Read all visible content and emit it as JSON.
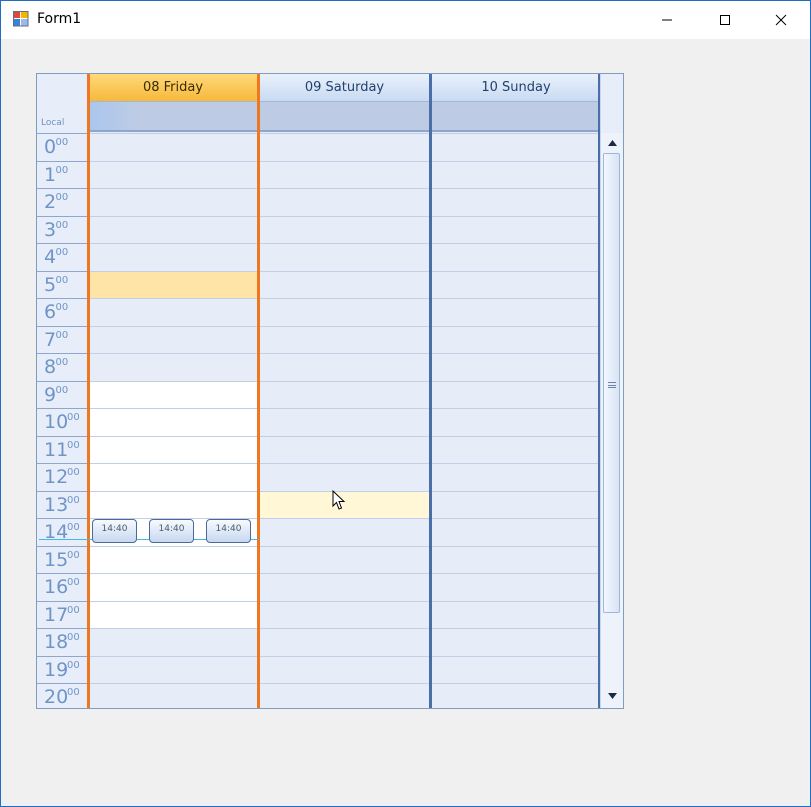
{
  "window": {
    "title": "Form1",
    "buttons": {
      "minimize": "minimize-icon",
      "maximize": "maximize-icon",
      "close": "close-icon"
    }
  },
  "scheduler": {
    "time_zone_label": "Local",
    "days": [
      {
        "label": "08 Friday",
        "today": true
      },
      {
        "label": "09 Saturday",
        "today": false
      },
      {
        "label": "10 Sunday",
        "today": false
      }
    ],
    "hours": [
      {
        "h": "0",
        "m": "00"
      },
      {
        "h": "1",
        "m": "00"
      },
      {
        "h": "2",
        "m": "00"
      },
      {
        "h": "3",
        "m": "00"
      },
      {
        "h": "4",
        "m": "00"
      },
      {
        "h": "5",
        "m": "00"
      },
      {
        "h": "6",
        "m": "00"
      },
      {
        "h": "7",
        "m": "00"
      },
      {
        "h": "8",
        "m": "00"
      },
      {
        "h": "9",
        "m": "00"
      },
      {
        "h": "10",
        "m": "00"
      },
      {
        "h": "11",
        "m": "00"
      },
      {
        "h": "12",
        "m": "00"
      },
      {
        "h": "13",
        "m": "00"
      },
      {
        "h": "14",
        "m": "00"
      },
      {
        "h": "15",
        "m": "00"
      },
      {
        "h": "16",
        "m": "00"
      },
      {
        "h": "17",
        "m": "00"
      },
      {
        "h": "18",
        "m": "00"
      },
      {
        "h": "19",
        "m": "00"
      },
      {
        "h": "20",
        "m": "00"
      }
    ],
    "appointments": [
      {
        "label": "14:40"
      },
      {
        "label": "14:40"
      },
      {
        "label": "14:40"
      }
    ],
    "colors": {
      "today_border": "#ee7722",
      "day_border": "#4a6fa8",
      "work_hours": "#ffffff",
      "off_hours": "#e7edf8",
      "selected_slot": "#ffe4a8",
      "hover_slot": "#fff7d6",
      "now_line": "#3fb9e8"
    }
  }
}
